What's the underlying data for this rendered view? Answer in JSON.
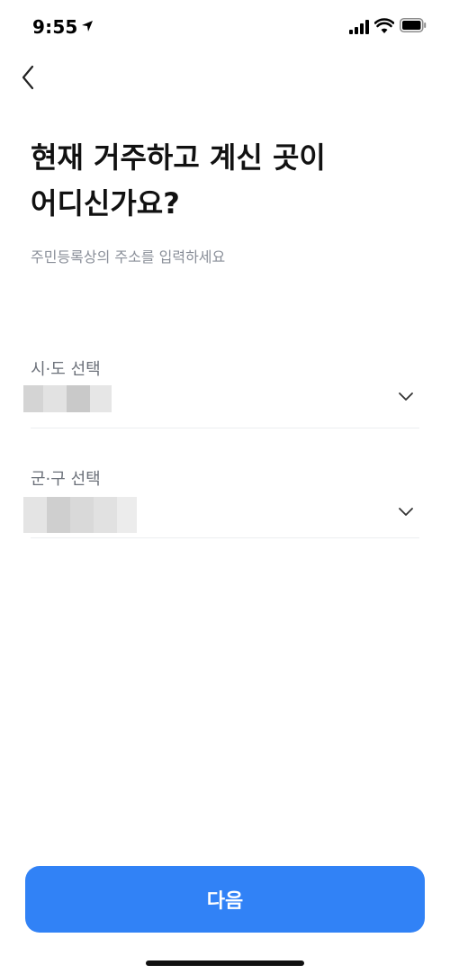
{
  "status_bar": {
    "time": "9:55",
    "icons": [
      "location-arrow-icon",
      "cellular-signal-icon",
      "wifi-icon",
      "battery-icon"
    ]
  },
  "nav": {
    "back_icon": "chevron-left-icon"
  },
  "header": {
    "title_line1": "현재 거주하고 계신 곳이",
    "title_line2": "어디신가요?",
    "subtitle": "주민등록상의 주소를 입력하세요"
  },
  "fields": [
    {
      "label": "시·도 선택",
      "value_state": "redacted",
      "icon": "chevron-down-icon"
    },
    {
      "label": "군·구 선택",
      "value_state": "redacted",
      "icon": "chevron-down-icon"
    }
  ],
  "footer": {
    "next_label": "다음"
  },
  "colors": {
    "accent": "#3182f6",
    "subtitle": "#8a8f99",
    "label": "#6b7079",
    "divider": "#eceef0"
  }
}
